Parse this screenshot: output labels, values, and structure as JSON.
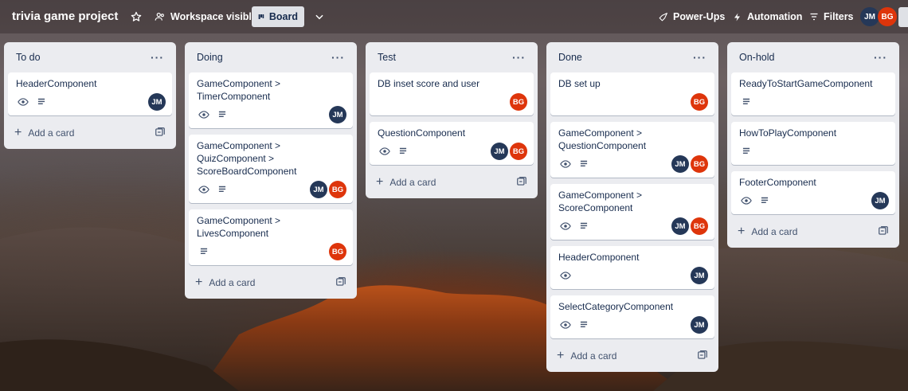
{
  "header": {
    "board_title": "trivia game project",
    "visibility": "Workspace visible",
    "view": "Board",
    "power_ups": "Power-Ups",
    "automation": "Automation",
    "filters": "Filters",
    "members": [
      "JM",
      "BG"
    ]
  },
  "add_card_label": "Add a card",
  "lists": [
    {
      "title": "To do",
      "cards": [
        {
          "title": "HeaderComponent",
          "watch": true,
          "desc": true,
          "members": [
            "JM"
          ]
        }
      ]
    },
    {
      "title": "Doing",
      "cards": [
        {
          "title": "GameComponent > TimerComponent",
          "watch": true,
          "desc": true,
          "members": [
            "JM"
          ]
        },
        {
          "title": "GameComponent > QuizComponent > ScoreBoardComponent",
          "watch": true,
          "desc": true,
          "members": [
            "JM",
            "BG"
          ]
        },
        {
          "title": "GameComponent > LivesComponent",
          "watch": false,
          "desc": true,
          "members": [
            "BG"
          ]
        }
      ]
    },
    {
      "title": "Test",
      "cards": [
        {
          "title": "DB inset score and user",
          "watch": false,
          "desc": false,
          "members": [
            "BG"
          ]
        },
        {
          "title": "QuestionComponent",
          "watch": true,
          "desc": true,
          "members": [
            "JM",
            "BG"
          ]
        }
      ]
    },
    {
      "title": "Done",
      "cards": [
        {
          "title": "DB set up",
          "watch": false,
          "desc": false,
          "members": [
            "BG"
          ]
        },
        {
          "title": "GameComponent > QuestionComponent",
          "watch": true,
          "desc": true,
          "members": [
            "JM",
            "BG"
          ]
        },
        {
          "title": "GameComponent > ScoreComponent",
          "watch": true,
          "desc": true,
          "members": [
            "JM",
            "BG"
          ]
        },
        {
          "title": "HeaderComponent",
          "watch": true,
          "desc": false,
          "members": [
            "JM"
          ]
        },
        {
          "title": "SelectCategoryComponent",
          "watch": true,
          "desc": true,
          "members": [
            "JM"
          ]
        }
      ]
    },
    {
      "title": "On-hold",
      "cards": [
        {
          "title": "ReadyToStartGameComponent",
          "watch": false,
          "desc": true,
          "members": []
        },
        {
          "title": "HowToPlayComponent",
          "watch": false,
          "desc": true,
          "members": []
        },
        {
          "title": "FooterComponent",
          "watch": true,
          "desc": true,
          "members": [
            "JM"
          ]
        }
      ]
    }
  ],
  "colors": {
    "jm": "#253858",
    "bg": "#de350b",
    "list_bg": "#ebecf0"
  },
  "icons": [
    "star-icon",
    "people-icon",
    "board-icon",
    "chevron-down-icon",
    "rocket-icon",
    "lightning-icon",
    "filter-icon",
    "eye-icon",
    "description-icon",
    "template-icon",
    "more-icon"
  ]
}
